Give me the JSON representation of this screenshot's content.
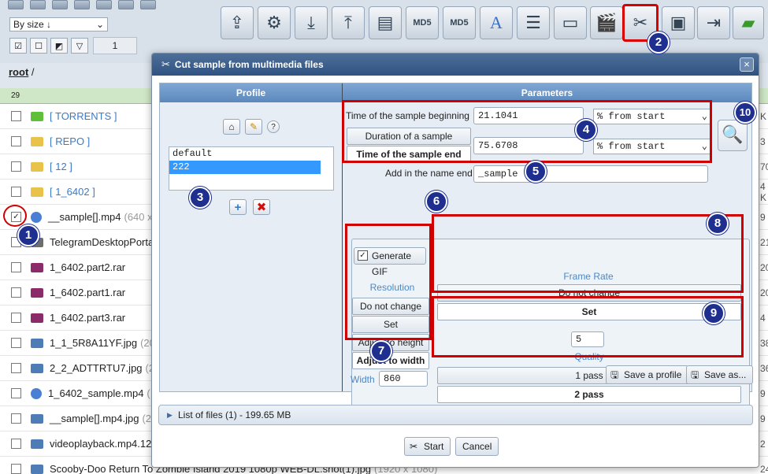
{
  "toolbar": {
    "sort_select": "By size ↓",
    "selected_count": "1",
    "tools": [
      "upload-icon",
      "settings-icon",
      "download-stack-icon",
      "upload-stack-icon",
      "archive-icon",
      "md5-file-icon",
      "md5-folder-icon",
      "rename-icon",
      "list-icon",
      "image-icon",
      "video-info-icon",
      "cut-sample-icon",
      "video-effects-icon",
      "move-icon",
      "new-folder-icon"
    ]
  },
  "breadcrumb": {
    "root": "root",
    "sep": "/"
  },
  "filelist": {
    "count": "29",
    "rows": [
      {
        "name": "[ TORRENTS ]",
        "meta": "",
        "type": "folder-green",
        "size": "K",
        "checked": false
      },
      {
        "name": "[ REPO ]",
        "meta": "",
        "type": "folder",
        "size": "3",
        "checked": false
      },
      {
        "name": "[ 12 ]",
        "meta": "",
        "type": "folder",
        "size": "70",
        "checked": false
      },
      {
        "name": "[ 1_6402 ]",
        "meta": "",
        "type": "folder",
        "size": "4 K",
        "checked": false
      },
      {
        "name": "__sample[].mp4",
        "meta": "(640 x",
        "type": "video",
        "size": "9",
        "checked": true
      },
      {
        "name": "TelegramDesktopPorta",
        "meta": "",
        "type": "app",
        "size": "21",
        "checked": false
      },
      {
        "name": "1_6402.part2.rar",
        "meta": "",
        "type": "rar",
        "size": "20",
        "checked": false
      },
      {
        "name": "1_6402.part1.rar",
        "meta": "",
        "type": "rar",
        "size": "20",
        "checked": false
      },
      {
        "name": "1_6402.part3.rar",
        "meta": "",
        "type": "rar",
        "size": "4",
        "checked": false
      },
      {
        "name": "1_1_5R8A11YF.jpg",
        "meta": "(20",
        "type": "image",
        "size": "38",
        "checked": false
      },
      {
        "name": "2_2_ADTTRTU7.jpg",
        "meta": "(20",
        "type": "image",
        "size": "36",
        "checked": false
      },
      {
        "name": "1_6402_sample.mp4",
        "meta": "(",
        "type": "video",
        "size": "9",
        "checked": false
      },
      {
        "name": "__sample[].mp4.jpg",
        "meta": "(20",
        "type": "image",
        "size": "9",
        "checked": false
      },
      {
        "name": "videoplayback.mp4.12",
        "meta": "",
        "type": "image",
        "size": "2",
        "checked": false
      },
      {
        "name": "Scooby-Doo Return To Zombie Island 2019 1080p WEB-DL.shot(1).jpg",
        "meta": "(1920 x 1080)",
        "type": "image",
        "size": "24",
        "checked": false
      }
    ]
  },
  "dialog": {
    "title": "Cut sample from multimedia files",
    "profile_header": "Profile",
    "params_header": "Parameters",
    "profiles": [
      "default",
      "222"
    ],
    "help": "?",
    "sample_begin_label": "Time of the sample beginning",
    "sample_begin_value": "21.1041",
    "begin_unit": "% from start",
    "duration_label": "Duration of a sample",
    "end_label": "Time of the sample end",
    "end_value": "75.6708",
    "end_unit": "% from start",
    "name_end_label": "Add in the name end",
    "name_end_value": "_sample",
    "generate_gif": "Generate GIF",
    "resolution_header": "Resolution",
    "res_options": [
      "Do not change",
      "Set",
      "Adjust to height",
      "Adjust to width"
    ],
    "width_label": "Width",
    "width_value": "860",
    "framerate_header": "Frame Rate",
    "fr_options": [
      "Do not change",
      "Set"
    ],
    "framerate_value": "5",
    "quality_header": "Quality",
    "quality_options": [
      "1 pass",
      "2 pass"
    ],
    "save_profile": "Save a profile",
    "save_as": "Save as...",
    "files_bar": "List of files (1) - 199.65 MB",
    "start": "Start",
    "cancel": "Cancel"
  },
  "callouts": [
    "1",
    "2",
    "3",
    "4",
    "5",
    "6",
    "7",
    "8",
    "9",
    "10"
  ],
  "colors": {
    "highlight": "#d00000",
    "callout": "#1e2f90",
    "title_bar": "#2f5382",
    "selected_profile": "#3399ff"
  }
}
